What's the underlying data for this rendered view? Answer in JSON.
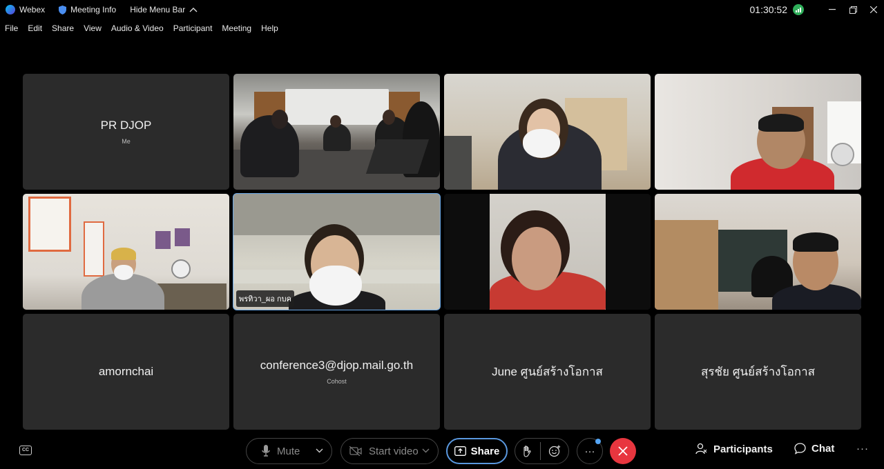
{
  "titlebar": {
    "app_name": "Webex",
    "meeting_info": "Meeting Info",
    "hide_menu": "Hide Menu Bar",
    "clock": "01:30:52"
  },
  "menu": [
    "File",
    "Edit",
    "Share",
    "View",
    "Audio & Video",
    "Participant",
    "Meeting",
    "Help"
  ],
  "tiles": [
    {
      "name": "PR DJOP",
      "sub": "Me",
      "type": "avatar"
    },
    {
      "name": "",
      "type": "video"
    },
    {
      "name": "",
      "type": "video"
    },
    {
      "name": "",
      "type": "video"
    },
    {
      "name": "",
      "type": "video"
    },
    {
      "name": "พรทิวา_ผอ กบค",
      "type": "video",
      "active": true
    },
    {
      "name": "",
      "type": "video"
    },
    {
      "name": "",
      "type": "video"
    },
    {
      "name": "amornchai",
      "sub": "",
      "type": "avatar"
    },
    {
      "name": "conference3@djop.mail.go.th",
      "sub": "Cohost",
      "type": "avatar"
    },
    {
      "name": "June ศูนย์สร้างโอกาส",
      "sub": "",
      "type": "avatar"
    },
    {
      "name": "สุรชัย ศูนย์สร้างโอกาส",
      "sub": "",
      "type": "avatar"
    }
  ],
  "toolbar": {
    "mute": "Mute",
    "start_video": "Start video",
    "share": "Share",
    "more": "···",
    "participants": "Participants",
    "chat": "Chat",
    "overflow": "···"
  },
  "colors": {
    "background": "#000000",
    "tile": "#2b2b2b",
    "active_speaker": "#6aa9ea",
    "leave": "#e8363f",
    "share_border": "#5a98df"
  }
}
